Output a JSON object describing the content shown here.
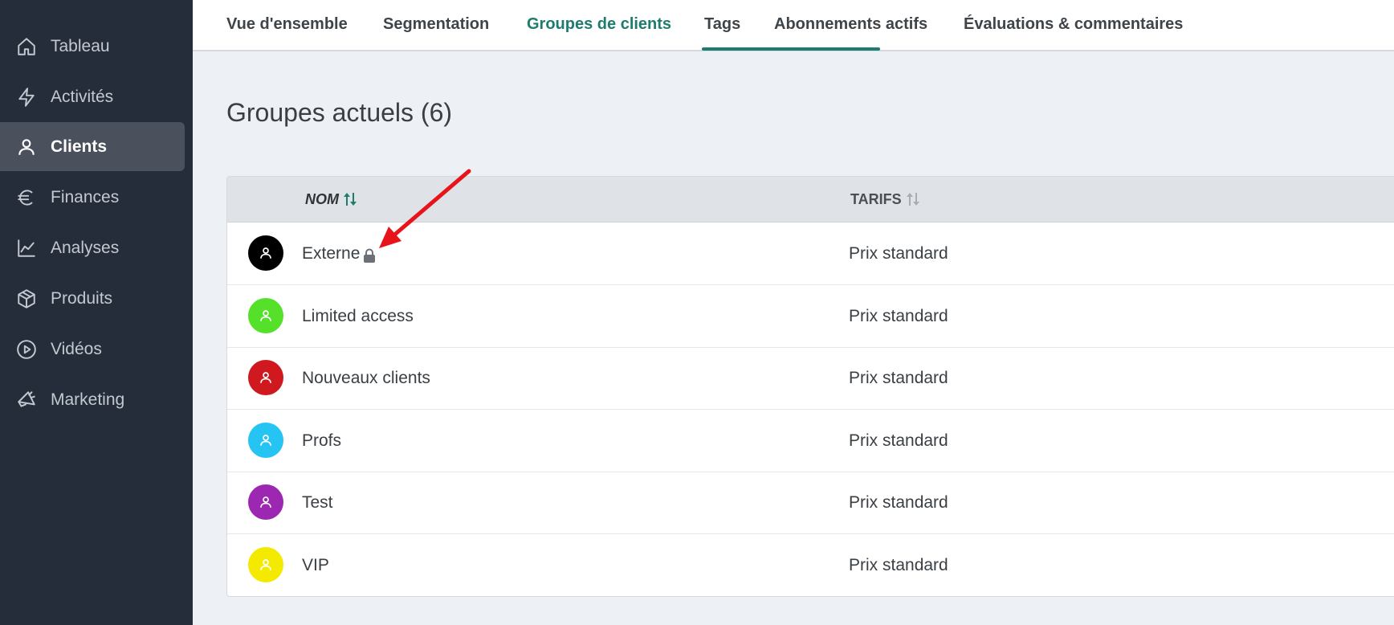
{
  "sidebar": {
    "items": [
      {
        "label": "Tableau",
        "icon": "home-icon",
        "active": false
      },
      {
        "label": "Activités",
        "icon": "lightning-icon",
        "active": false
      },
      {
        "label": "Clients",
        "icon": "user-icon",
        "active": true
      },
      {
        "label": "Finances",
        "icon": "euro-icon",
        "active": false
      },
      {
        "label": "Analyses",
        "icon": "line-chart-icon",
        "active": false
      },
      {
        "label": "Produits",
        "icon": "box-icon",
        "active": false
      },
      {
        "label": "Vidéos",
        "icon": "play-circle-icon",
        "active": false
      },
      {
        "label": "Marketing",
        "icon": "megaphone-icon",
        "active": false
      }
    ]
  },
  "tabs": [
    {
      "label": "Vue d'ensemble",
      "active": false
    },
    {
      "label": "Segmentation",
      "active": false
    },
    {
      "label": "Groupes de clients",
      "active": true
    },
    {
      "label": "Tags",
      "active": false
    },
    {
      "label": "Abonnements actifs",
      "active": false
    },
    {
      "label": "Évaluations & commentaires",
      "active": false
    }
  ],
  "page": {
    "title": "Groupes actuels (6)"
  },
  "table": {
    "columns": [
      {
        "label": "NOM",
        "sort_icon": "sort-arrows-icon",
        "sort_active": true
      },
      {
        "label": "TARIFS",
        "sort_icon": "sort-arrows-icon",
        "sort_active": false
      }
    ],
    "rows": [
      {
        "name": "Externe",
        "tarif": "Prix standard",
        "color": "#000000",
        "locked": true
      },
      {
        "name": "Limited access",
        "tarif": "Prix standard",
        "color": "#55e02a",
        "locked": false
      },
      {
        "name": "Nouveaux clients",
        "tarif": "Prix standard",
        "color": "#d0191f",
        "locked": false
      },
      {
        "name": "Profs",
        "tarif": "Prix standard",
        "color": "#26c4f3",
        "locked": false
      },
      {
        "name": "Test",
        "tarif": "Prix standard",
        "color": "#9c27b0",
        "locked": false
      },
      {
        "name": "VIP",
        "tarif": "Prix standard",
        "color": "#f4ea00",
        "locked": false
      }
    ]
  },
  "colors": {
    "sidebar_bg": "#262d3a",
    "accent": "#1e7c6e",
    "annotation_arrow": "#e8141b"
  }
}
